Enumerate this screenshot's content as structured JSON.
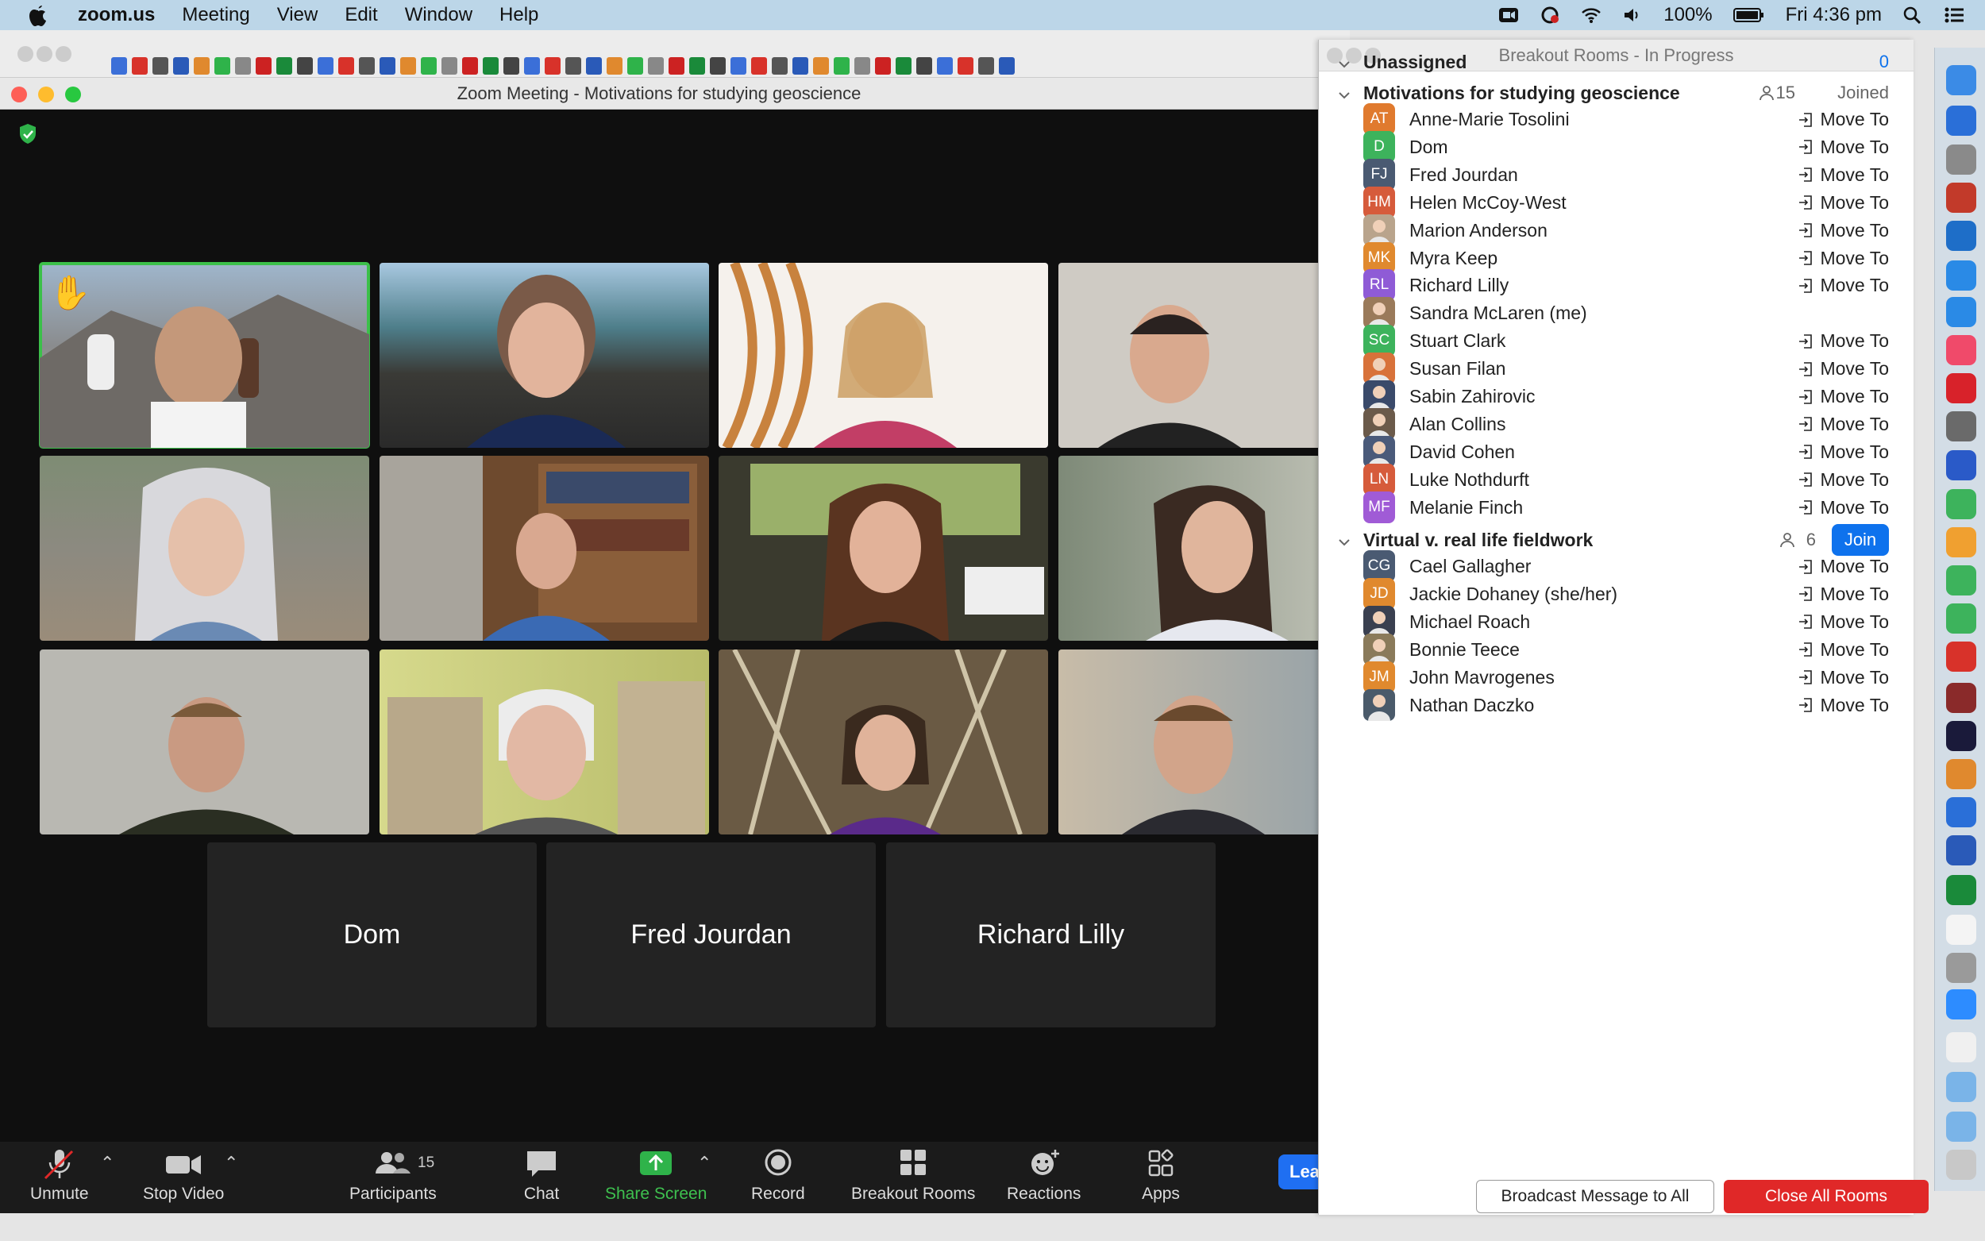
{
  "menubar": {
    "items": [
      "zoom.us",
      "Meeting",
      "View",
      "Edit",
      "Window",
      "Help"
    ],
    "battery": "100%",
    "clock": "Fri 4:36 pm"
  },
  "zoom": {
    "window_title": "Zoom Meeting - Motivations for studying geoscience",
    "name_tiles": [
      "Dom",
      "Fred Jourdan",
      "Richard Lilly"
    ],
    "toolbar": {
      "unmute": "Unmute",
      "stop_video": "Stop Video",
      "participants": "Participants",
      "participants_count": "15",
      "chat": "Chat",
      "share_screen": "Share Screen",
      "record": "Record",
      "breakout_rooms": "Breakout Rooms",
      "reactions": "Reactions",
      "apps": "Apps",
      "leave": "Lea"
    }
  },
  "breakout": {
    "title": "Breakout Rooms - In Progress",
    "unassigned": {
      "label": "Unassigned",
      "count": "0"
    },
    "move_label": "Move To",
    "rooms": [
      {
        "name": "Motivations for studying geoscience",
        "count": "15",
        "status": "Joined",
        "people": [
          {
            "initials": "AT",
            "name": "Anne-Marie Tosolini",
            "color": "#e07a2e",
            "move": true
          },
          {
            "initials": "D",
            "name": "Dom",
            "color": "#3db35c",
            "move": true
          },
          {
            "initials": "FJ",
            "name": "Fred Jourdan",
            "color": "#4a5a72",
            "move": true
          },
          {
            "initials": "HM",
            "name": "Helen McCoy-West",
            "color": "#d65b3b",
            "move": true
          },
          {
            "initials": "",
            "name": "Marion Anderson",
            "color": "#b9a48c",
            "move": true
          },
          {
            "initials": "MK",
            "name": "Myra Keep",
            "color": "#e0892e",
            "move": true
          },
          {
            "initials": "RL",
            "name": "Richard Lilly",
            "color": "#8f5bd6",
            "move": true
          },
          {
            "initials": "",
            "name": "Sandra McLaren (me)",
            "color": "#9a7a5a",
            "move": false
          },
          {
            "initials": "SC",
            "name": "Stuart Clark",
            "color": "#3db35c",
            "move": true
          },
          {
            "initials": "",
            "name": "Susan Filan",
            "color": "#d8723a",
            "move": true
          },
          {
            "initials": "",
            "name": "Sabin Zahirovic",
            "color": "#3a4a6a",
            "move": true
          },
          {
            "initials": "",
            "name": "Alan Collins",
            "color": "#6b5a4a",
            "move": true
          },
          {
            "initials": "",
            "name": "David Cohen",
            "color": "#4a5a7a",
            "move": true
          },
          {
            "initials": "LN",
            "name": "Luke Nothdurft",
            "color": "#d65b3b",
            "move": true
          },
          {
            "initials": "MF",
            "name": "Melanie Finch",
            "color": "#a05bd6",
            "move": true
          }
        ]
      },
      {
        "name": "Virtual v. real life fieldwork",
        "count": "6",
        "status": "Join",
        "people": [
          {
            "initials": "CG",
            "name": "Cael Gallagher",
            "color": "#4a5a72",
            "move": true
          },
          {
            "initials": "JD",
            "name": "Jackie Dohaney (she/her)",
            "color": "#e0892e",
            "move": true
          },
          {
            "initials": "",
            "name": "Michael Roach",
            "color": "#3a4050",
            "move": true
          },
          {
            "initials": "",
            "name": "Bonnie Teece",
            "color": "#8a7a5a",
            "move": true
          },
          {
            "initials": "JM",
            "name": "John Mavrogenes",
            "color": "#e0892e",
            "move": true
          },
          {
            "initials": "",
            "name": "Nathan Daczko",
            "color": "#4a5a6a",
            "move": true
          }
        ]
      }
    ],
    "broadcast": "Broadcast Message to All",
    "close_all": "Close All Rooms"
  },
  "colors": {
    "accent_blue": "#0e72ed",
    "active_speaker": "#3cc04a",
    "close_red": "#e02828"
  }
}
